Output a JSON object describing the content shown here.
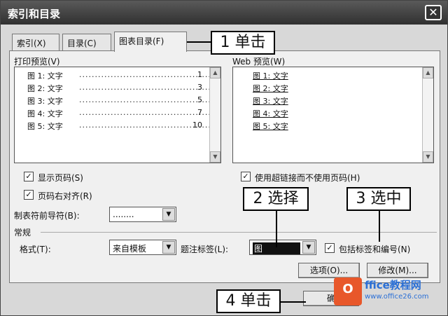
{
  "window": {
    "title": "索引和目录",
    "close_glyph": "✕"
  },
  "tabs": [
    {
      "label": "索引(X)"
    },
    {
      "label": "目录(C)"
    },
    {
      "label": "图表目录(F)"
    }
  ],
  "print_preview": {
    "label": "打印预览(V)",
    "rows": [
      {
        "label": "图 1: 文字",
        "dots": "......................................................",
        "page": "1"
      },
      {
        "label": "图 2: 文字",
        "dots": "......................................................",
        "page": "3"
      },
      {
        "label": "图 3: 文字",
        "dots": "......................................................",
        "page": "5"
      },
      {
        "label": "图 4: 文字",
        "dots": "......................................................",
        "page": "7"
      },
      {
        "label": "图 5: 文字",
        "dots": "......................................................",
        "page": "10"
      }
    ]
  },
  "web_preview": {
    "label": "Web 预览(W)",
    "rows": [
      "图 1: 文字",
      "图 2: 文字",
      "图 3: 文字",
      "图 4: 文字",
      "图 5: 文字"
    ]
  },
  "options": {
    "show_page_numbers": "显示页码(S)",
    "right_align_page_numbers": "页码右对齐(R)",
    "use_hyperlinks": "使用超链接而不使用页码(H)",
    "tab_leader_label": "制表符前导符(B):",
    "tab_leader_value": "........"
  },
  "general": {
    "label": "常规",
    "format_label": "格式(T):",
    "format_value": "来自模板",
    "caption_label": "题注标签(L):",
    "caption_value": "图",
    "include_label": "包括标签和编号(N)"
  },
  "buttons": {
    "options": "选项(O)...",
    "modify": "修改(M)...",
    "ok": "确"
  },
  "callouts": {
    "step1": "1 单击",
    "step2": "2 选择",
    "step3": "3 选中",
    "step4": "4 单击"
  },
  "watermark": {
    "mark": "O",
    "brand": "ffice教程网",
    "url": "www.office26.com"
  },
  "colors": {
    "title_bar": "#303030",
    "logo_orange": "#e8572a",
    "logo_blue": "#2a6fd6"
  }
}
